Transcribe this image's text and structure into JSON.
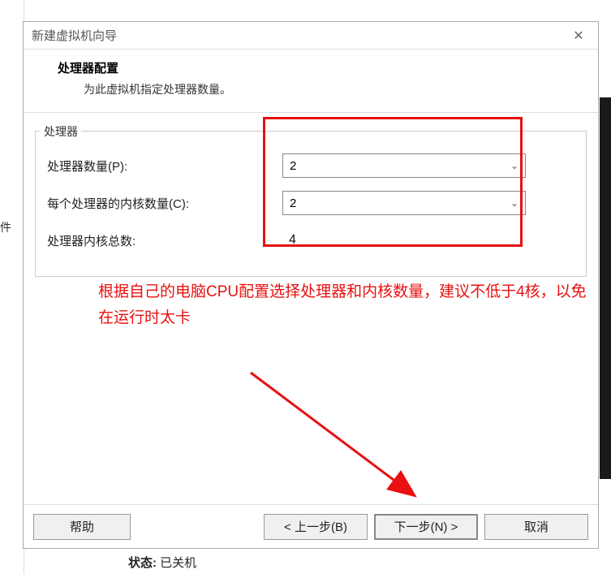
{
  "background": {
    "left_text_fragment": "件",
    "status_label": "状态:",
    "status_value": "已关机"
  },
  "dialog": {
    "title": "新建虚拟机向导",
    "header_title": "处理器配置",
    "header_sub": "为此虚拟机指定处理器数量。",
    "fieldset_legend": "处理器",
    "rows": {
      "proc_count_label": "处理器数量(P):",
      "proc_count_value": "2",
      "cores_per_label": "每个处理器的内核数量(C):",
      "cores_per_value": "2",
      "total_cores_label": "处理器内核总数:",
      "total_cores_value": "4"
    },
    "annotation": "根据自己的电脑CPU配置选择处理器和内核数量，建议不低于4核，以免在运行时太卡",
    "buttons": {
      "help": "帮助",
      "back": "< 上一步(B)",
      "next": "下一步(N) >",
      "cancel": "取消"
    }
  }
}
